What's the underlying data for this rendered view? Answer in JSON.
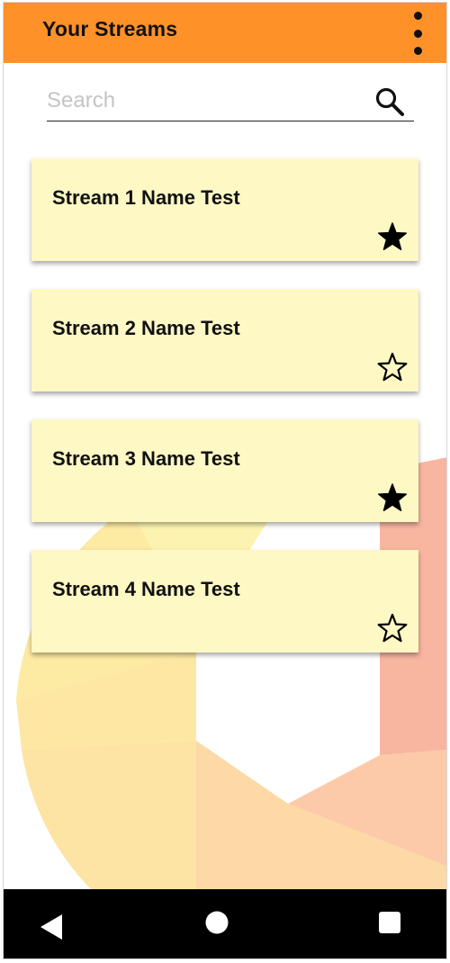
{
  "colors": {
    "app_bar": "#ff9129",
    "card": "#fef8c4",
    "nav_bar": "#000000"
  },
  "header": {
    "title": "Your Streams",
    "menu_icon": "more-vertical-icon"
  },
  "search": {
    "placeholder": "Search",
    "value": "",
    "icon": "search-icon"
  },
  "streams": [
    {
      "name": "Stream 1 Name Test",
      "favorite": true
    },
    {
      "name": "Stream 2 Name Test",
      "favorite": false
    },
    {
      "name": "Stream 3 Name Test",
      "favorite": true
    },
    {
      "name": "Stream 4 Name Test",
      "favorite": false
    }
  ],
  "nav": {
    "back_icon": "back-triangle-icon",
    "home_icon": "home-circle-icon",
    "recents_icon": "recents-square-icon"
  }
}
